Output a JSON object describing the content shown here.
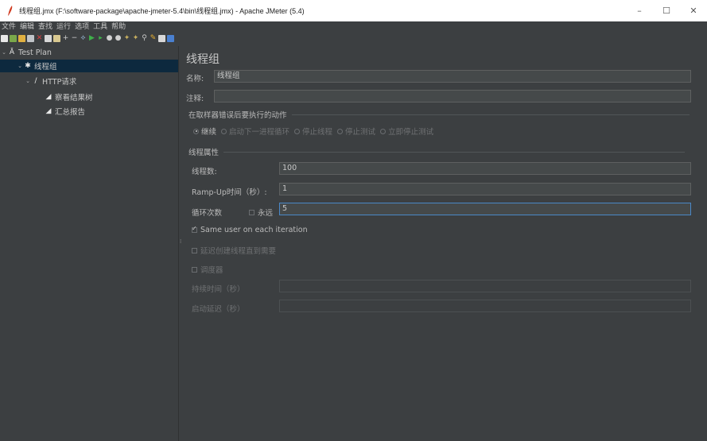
{
  "window": {
    "title": "线程组.jmx (F:\\software-package\\apache-jmeter-5.4\\bin\\线程组.jmx) - Apache JMeter (5.4)",
    "controls": [
      "–",
      "☐",
      "✕"
    ]
  },
  "menu": [
    "文件",
    "编辑",
    "查找",
    "运行",
    "选项",
    "工具",
    "帮助"
  ],
  "toolbar": {
    "icons": [
      "new-icon",
      "templates-icon",
      "open-icon",
      "save-icon",
      "cut-icon",
      "copy-icon",
      "paste-icon",
      "expand-icon",
      "collapse-icon",
      "toggle-icon",
      "start-icon",
      "start-no-pause-icon",
      "stop-icon",
      "shutdown-icon",
      "clear-icon",
      "clear-all-icon",
      "search-icon",
      "reset-search-icon",
      "function-helper-icon",
      "help-icon"
    ]
  },
  "tree": [
    {
      "label": "Test Plan",
      "depth": 0,
      "icon": "test-plan-icon",
      "expanded": true
    },
    {
      "label": "线程组",
      "depth": 1,
      "icon": "thread-group-icon",
      "expanded": true,
      "selected": true
    },
    {
      "label": "HTTP请求",
      "depth": 2,
      "icon": "sampler-icon",
      "expanded": true
    },
    {
      "label": "察看结果树",
      "depth": 3,
      "icon": "listener-icon"
    },
    {
      "label": "汇总报告",
      "depth": 3,
      "icon": "listener-icon"
    }
  ],
  "panel": {
    "title": "线程组",
    "name_label": "名称:",
    "name_value": "线程组",
    "comment_label": "注释:",
    "comment_value": "",
    "action_section": "在取样器错误后要执行的动作",
    "actions": [
      {
        "label": "继续",
        "selected": true
      },
      {
        "label": "启动下一进程循环",
        "selected": false
      },
      {
        "label": "停止线程",
        "selected": false
      },
      {
        "label": "停止测试",
        "selected": false
      },
      {
        "label": "立即停止测试",
        "selected": false
      }
    ],
    "props_section": "线程属性",
    "threads_label": "线程数:",
    "threads_value": "100",
    "rampup_label": "Ramp-Up时间（秒）:",
    "rampup_value": "1",
    "loop_label": "循环次数",
    "forever_label": "永远",
    "forever_checked": false,
    "loop_value": "5",
    "same_user_label": "Same user on each iteration",
    "same_user_checked": true,
    "delay_label": "延迟创建线程直到需要",
    "delay_checked": false,
    "scheduler_label": "调度器",
    "scheduler_checked": false,
    "duration_label": "持续时间（秒）",
    "duration_value": "",
    "startup_delay_label": "启动延迟（秒）",
    "startup_delay_value": ""
  },
  "colors": {
    "background": "#3c3f41",
    "selection": "#0d293e",
    "field": "#45494a",
    "focus_border": "#4a88c7"
  }
}
